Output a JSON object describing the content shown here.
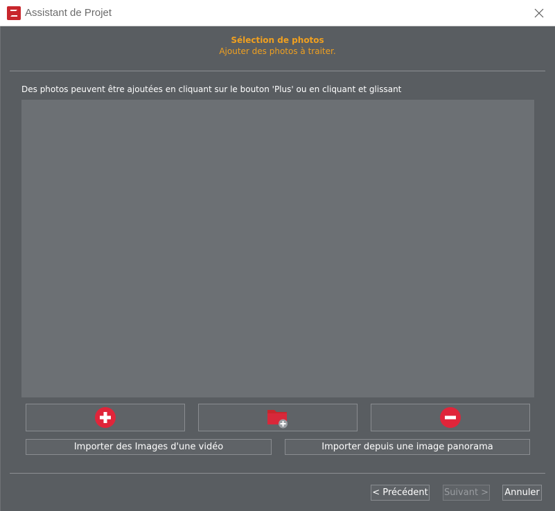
{
  "window": {
    "title": "Assistant de Projet"
  },
  "header": {
    "title": "Sélection de photos",
    "subtitle": "Ajouter des photos à traiter."
  },
  "main": {
    "instruction": "Des photos peuvent être ajoutées en cliquant sur le bouton 'Plus' ou en cliquant et glissant",
    "photo_list": []
  },
  "actions": {
    "add_icon": "plus-circle-icon",
    "add_folder_icon": "folder-add-icon",
    "remove_icon": "minus-circle-icon",
    "import_video_label": "Importer des Images d'une vidéo",
    "import_panorama_label": "Importer depuis une image panorama"
  },
  "navigation": {
    "previous_label": "< Précédent",
    "next_label": "Suivant >",
    "cancel_label": "Annuler"
  },
  "colors": {
    "accent": "#f0a020",
    "brand_red": "#c8262c",
    "icon_red": "#e0253a",
    "panel_bg": "#595d61",
    "list_bg": "#6c7074"
  }
}
